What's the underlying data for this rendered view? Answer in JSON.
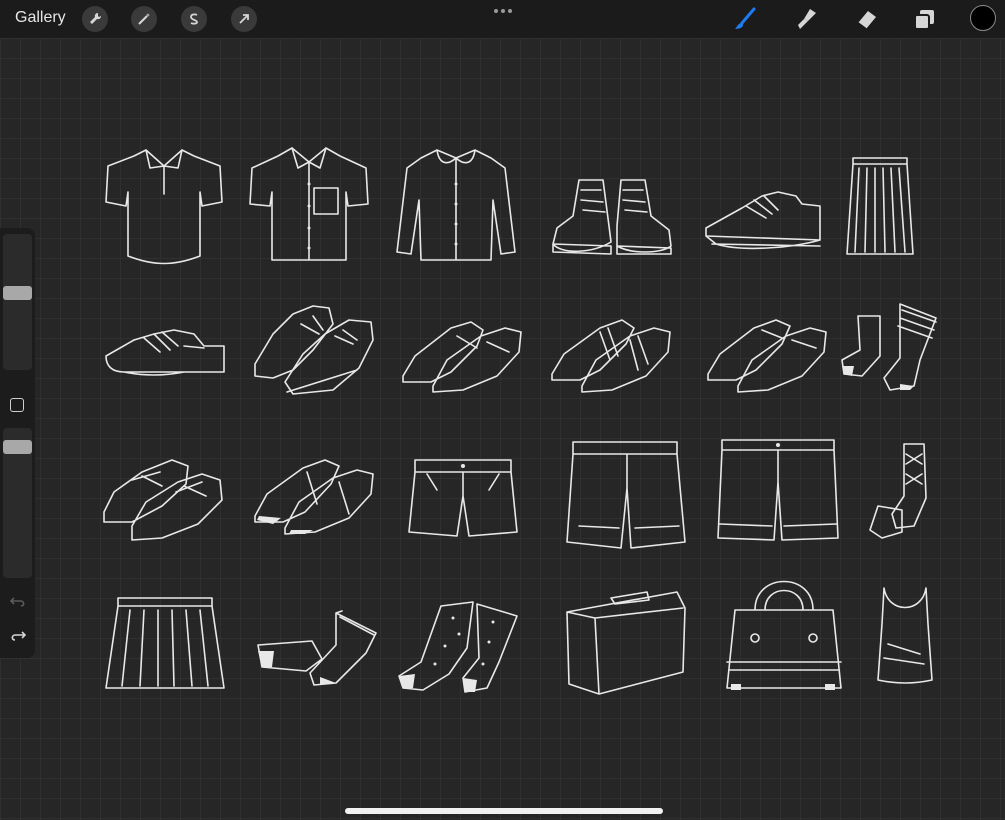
{
  "toolbar": {
    "gallery_label": "Gallery",
    "left_tools": [
      "wrench-icon",
      "magic-wand-icon",
      "selection-s-icon",
      "transform-arrow-icon"
    ],
    "right_tools": [
      "brush-icon",
      "smudge-icon",
      "eraser-icon",
      "layers-icon"
    ],
    "active_tool": "brush",
    "active_color": "#000000",
    "accent": "#1f7bf2"
  },
  "sidebar": {
    "controls": [
      "brush-size-slider",
      "modify-button",
      "opacity-slider",
      "undo-icon",
      "redo-icon"
    ]
  },
  "canvas": {
    "items": [
      "polo-shirt",
      "button-shirt-with-pocket",
      "long-sleeve-blouse",
      "high-top-sneakers",
      "low-sneaker",
      "pleated-long-skirt",
      "saddle-shoes",
      "lace-up-shoes",
      "slip-on-shoes",
      "strap-shoes",
      "loafers",
      "striped-socks",
      "sneakers-laced",
      "mary-jane-shoes",
      "shorts",
      "cargo-shorts",
      "chino-shorts",
      "argyle-socks",
      "pleated-skirt",
      "ankle-socks",
      "polka-dot-socks",
      "suitcase",
      "handbag",
      "tank-top"
    ]
  }
}
